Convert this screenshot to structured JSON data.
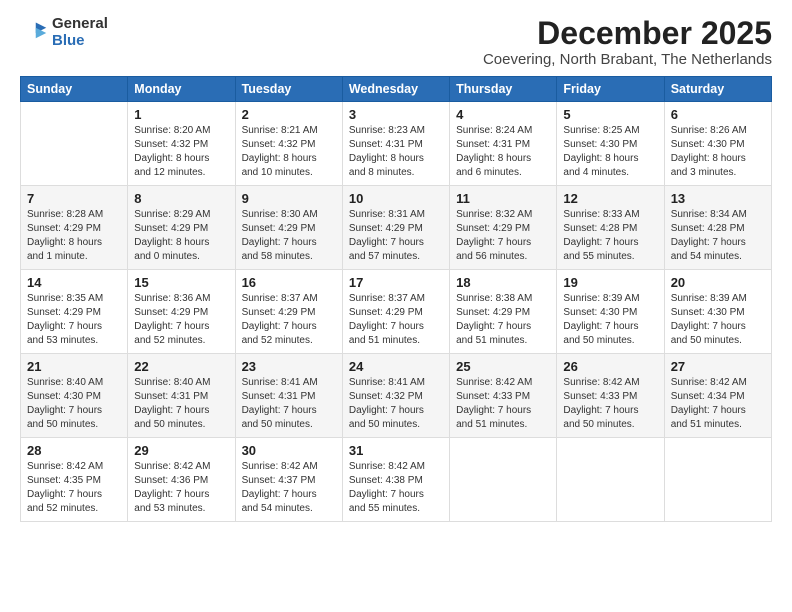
{
  "logo": {
    "general": "General",
    "blue": "Blue"
  },
  "title": "December 2025",
  "subtitle": "Coevering, North Brabant, The Netherlands",
  "days_header": [
    "Sunday",
    "Monday",
    "Tuesday",
    "Wednesday",
    "Thursday",
    "Friday",
    "Saturday"
  ],
  "weeks": [
    [
      {
        "day": "",
        "sunrise": "",
        "sunset": "",
        "daylight": ""
      },
      {
        "day": "1",
        "sunrise": "Sunrise: 8:20 AM",
        "sunset": "Sunset: 4:32 PM",
        "daylight": "Daylight: 8 hours and 12 minutes."
      },
      {
        "day": "2",
        "sunrise": "Sunrise: 8:21 AM",
        "sunset": "Sunset: 4:32 PM",
        "daylight": "Daylight: 8 hours and 10 minutes."
      },
      {
        "day": "3",
        "sunrise": "Sunrise: 8:23 AM",
        "sunset": "Sunset: 4:31 PM",
        "daylight": "Daylight: 8 hours and 8 minutes."
      },
      {
        "day": "4",
        "sunrise": "Sunrise: 8:24 AM",
        "sunset": "Sunset: 4:31 PM",
        "daylight": "Daylight: 8 hours and 6 minutes."
      },
      {
        "day": "5",
        "sunrise": "Sunrise: 8:25 AM",
        "sunset": "Sunset: 4:30 PM",
        "daylight": "Daylight: 8 hours and 4 minutes."
      },
      {
        "day": "6",
        "sunrise": "Sunrise: 8:26 AM",
        "sunset": "Sunset: 4:30 PM",
        "daylight": "Daylight: 8 hours and 3 minutes."
      }
    ],
    [
      {
        "day": "7",
        "sunrise": "Sunrise: 8:28 AM",
        "sunset": "Sunset: 4:29 PM",
        "daylight": "Daylight: 8 hours and 1 minute."
      },
      {
        "day": "8",
        "sunrise": "Sunrise: 8:29 AM",
        "sunset": "Sunset: 4:29 PM",
        "daylight": "Daylight: 8 hours and 0 minutes."
      },
      {
        "day": "9",
        "sunrise": "Sunrise: 8:30 AM",
        "sunset": "Sunset: 4:29 PM",
        "daylight": "Daylight: 7 hours and 58 minutes."
      },
      {
        "day": "10",
        "sunrise": "Sunrise: 8:31 AM",
        "sunset": "Sunset: 4:29 PM",
        "daylight": "Daylight: 7 hours and 57 minutes."
      },
      {
        "day": "11",
        "sunrise": "Sunrise: 8:32 AM",
        "sunset": "Sunset: 4:29 PM",
        "daylight": "Daylight: 7 hours and 56 minutes."
      },
      {
        "day": "12",
        "sunrise": "Sunrise: 8:33 AM",
        "sunset": "Sunset: 4:28 PM",
        "daylight": "Daylight: 7 hours and 55 minutes."
      },
      {
        "day": "13",
        "sunrise": "Sunrise: 8:34 AM",
        "sunset": "Sunset: 4:28 PM",
        "daylight": "Daylight: 7 hours and 54 minutes."
      }
    ],
    [
      {
        "day": "14",
        "sunrise": "Sunrise: 8:35 AM",
        "sunset": "Sunset: 4:29 PM",
        "daylight": "Daylight: 7 hours and 53 minutes."
      },
      {
        "day": "15",
        "sunrise": "Sunrise: 8:36 AM",
        "sunset": "Sunset: 4:29 PM",
        "daylight": "Daylight: 7 hours and 52 minutes."
      },
      {
        "day": "16",
        "sunrise": "Sunrise: 8:37 AM",
        "sunset": "Sunset: 4:29 PM",
        "daylight": "Daylight: 7 hours and 52 minutes."
      },
      {
        "day": "17",
        "sunrise": "Sunrise: 8:37 AM",
        "sunset": "Sunset: 4:29 PM",
        "daylight": "Daylight: 7 hours and 51 minutes."
      },
      {
        "day": "18",
        "sunrise": "Sunrise: 8:38 AM",
        "sunset": "Sunset: 4:29 PM",
        "daylight": "Daylight: 7 hours and 51 minutes."
      },
      {
        "day": "19",
        "sunrise": "Sunrise: 8:39 AM",
        "sunset": "Sunset: 4:30 PM",
        "daylight": "Daylight: 7 hours and 50 minutes."
      },
      {
        "day": "20",
        "sunrise": "Sunrise: 8:39 AM",
        "sunset": "Sunset: 4:30 PM",
        "daylight": "Daylight: 7 hours and 50 minutes."
      }
    ],
    [
      {
        "day": "21",
        "sunrise": "Sunrise: 8:40 AM",
        "sunset": "Sunset: 4:30 PM",
        "daylight": "Daylight: 7 hours and 50 minutes."
      },
      {
        "day": "22",
        "sunrise": "Sunrise: 8:40 AM",
        "sunset": "Sunset: 4:31 PM",
        "daylight": "Daylight: 7 hours and 50 minutes."
      },
      {
        "day": "23",
        "sunrise": "Sunrise: 8:41 AM",
        "sunset": "Sunset: 4:31 PM",
        "daylight": "Daylight: 7 hours and 50 minutes."
      },
      {
        "day": "24",
        "sunrise": "Sunrise: 8:41 AM",
        "sunset": "Sunset: 4:32 PM",
        "daylight": "Daylight: 7 hours and 50 minutes."
      },
      {
        "day": "25",
        "sunrise": "Sunrise: 8:42 AM",
        "sunset": "Sunset: 4:33 PM",
        "daylight": "Daylight: 7 hours and 51 minutes."
      },
      {
        "day": "26",
        "sunrise": "Sunrise: 8:42 AM",
        "sunset": "Sunset: 4:33 PM",
        "daylight": "Daylight: 7 hours and 50 minutes."
      },
      {
        "day": "27",
        "sunrise": "Sunrise: 8:42 AM",
        "sunset": "Sunset: 4:34 PM",
        "daylight": "Daylight: 7 hours and 51 minutes."
      }
    ],
    [
      {
        "day": "28",
        "sunrise": "Sunrise: 8:42 AM",
        "sunset": "Sunset: 4:35 PM",
        "daylight": "Daylight: 7 hours and 52 minutes."
      },
      {
        "day": "29",
        "sunrise": "Sunrise: 8:42 AM",
        "sunset": "Sunset: 4:36 PM",
        "daylight": "Daylight: 7 hours and 53 minutes."
      },
      {
        "day": "30",
        "sunrise": "Sunrise: 8:42 AM",
        "sunset": "Sunset: 4:37 PM",
        "daylight": "Daylight: 7 hours and 54 minutes."
      },
      {
        "day": "31",
        "sunrise": "Sunrise: 8:42 AM",
        "sunset": "Sunset: 4:38 PM",
        "daylight": "Daylight: 7 hours and 55 minutes."
      },
      {
        "day": "",
        "sunrise": "",
        "sunset": "",
        "daylight": ""
      },
      {
        "day": "",
        "sunrise": "",
        "sunset": "",
        "daylight": ""
      },
      {
        "day": "",
        "sunrise": "",
        "sunset": "",
        "daylight": ""
      }
    ]
  ]
}
